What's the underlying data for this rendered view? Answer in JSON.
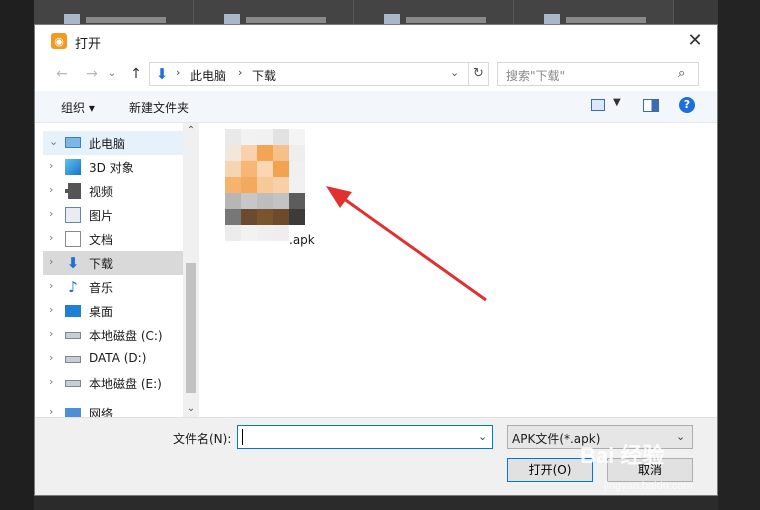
{
  "window": {
    "title": "打开",
    "close_glyph": "✕"
  },
  "nav": {
    "back_glyph": "←",
    "forward_glyph": "→",
    "up_glyph": "↑",
    "breadcrumbs": [
      "此电脑",
      "下载"
    ],
    "refresh_glyph": "↻",
    "search_placeholder": "搜索\"下载\"",
    "search_glyph": "⌕"
  },
  "toolbar": {
    "organize_label": "组织 ▾",
    "new_folder_label": "新建文件夹",
    "help_glyph": "?"
  },
  "sidebar": {
    "items": [
      {
        "label": "此电脑",
        "icon": "computer-icon",
        "chevron": "⌄"
      },
      {
        "label": "3D 对象",
        "icon": "3d-objects-icon",
        "chevron": "›"
      },
      {
        "label": "视频",
        "icon": "video-icon",
        "chevron": "›"
      },
      {
        "label": "图片",
        "icon": "picture-icon",
        "chevron": "›"
      },
      {
        "label": "文档",
        "icon": "document-icon",
        "chevron": "›"
      },
      {
        "label": "下载",
        "icon": "download-icon",
        "chevron": "›",
        "selected": true
      },
      {
        "label": "音乐",
        "icon": "music-icon",
        "chevron": "›"
      },
      {
        "label": "桌面",
        "icon": "desktop-icon",
        "chevron": "›"
      },
      {
        "label": "本地磁盘 (C:)",
        "icon": "drive-icon",
        "chevron": "›"
      },
      {
        "label": "DATA (D:)",
        "icon": "drive-icon",
        "chevron": "›"
      },
      {
        "label": "本地磁盘 (E:)",
        "icon": "drive-icon",
        "chevron": "›"
      },
      {
        "label": "网络",
        "icon": "network-icon",
        "chevron": "›"
      }
    ]
  },
  "content": {
    "file_name": ".apk"
  },
  "bottom": {
    "filename_label": "文件名(N):",
    "filename_value": "",
    "filetype_value": "APK文件(*.apk)",
    "open_label": "打开(O)",
    "cancel_label": "取消"
  },
  "watermark": {
    "text": "Bai 经验",
    "sub": "jingyan.baidu.com"
  },
  "colors": {
    "accent": "#0078d7",
    "annotation_arrow": "#e03030",
    "app_icon": "#f29b1e"
  }
}
